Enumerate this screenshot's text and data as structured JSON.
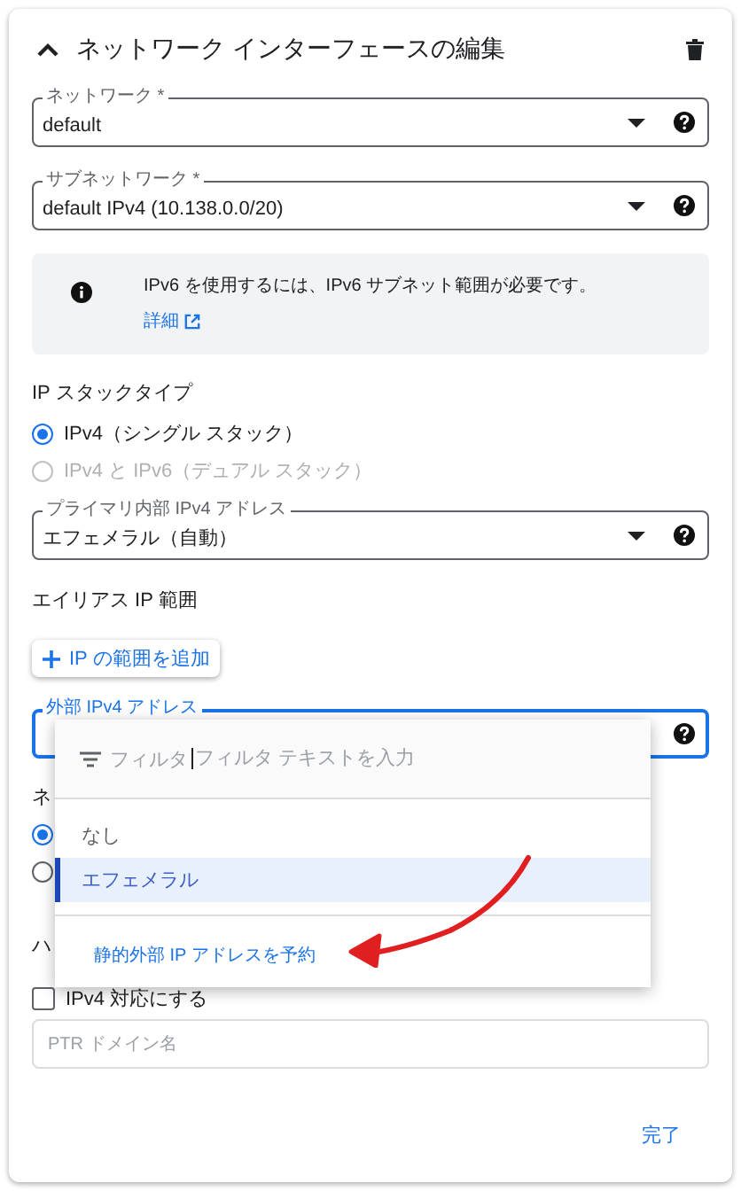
{
  "header": {
    "title": "ネットワーク インターフェースの編集",
    "expanded": true
  },
  "network_field": {
    "label": "ネットワーク *",
    "value": "default"
  },
  "subnetwork_field": {
    "label": "サブネットワーク *",
    "value": "default IPv4 (10.138.0.0/20)"
  },
  "info": {
    "text": "IPv6 を使用するには、IPv6 サブネット範囲が必要です。",
    "link": "詳細"
  },
  "ip_stack": {
    "heading": "IP スタックタイプ",
    "options": [
      {
        "label": "IPv4（シングル スタック）",
        "selected": true,
        "disabled": false
      },
      {
        "label": "IPv4 と IPv6（デュアル スタック）",
        "selected": false,
        "disabled": true
      }
    ]
  },
  "primary_field": {
    "label": "プライマリ内部 IPv4 アドレス",
    "value": "エフェメラル（自動）"
  },
  "alias": {
    "heading": "エイリアス IP 範囲",
    "button": "IP の範囲を追加"
  },
  "external_field": {
    "label": "外部 IPv4 アドレス",
    "focused": true
  },
  "dropdown": {
    "filter_label": "フィルタ",
    "placeholder": "フィルタ テキストを入力",
    "options": [
      {
        "label": "なし",
        "selected": false
      },
      {
        "label": "エフェメラル",
        "selected": true
      }
    ],
    "action": "静的外部 IP アドレスを予約"
  },
  "hidden_section": {
    "heading": "ネ",
    "options": [
      {
        "selected": true
      },
      {
        "selected": false
      }
    ]
  },
  "ptr_section": {
    "heading": "ハ",
    "checkbox": {
      "label": "IPv4 対応にする",
      "checked": false
    },
    "placeholder": "PTR ドメイン名"
  },
  "done_button": "完了"
}
